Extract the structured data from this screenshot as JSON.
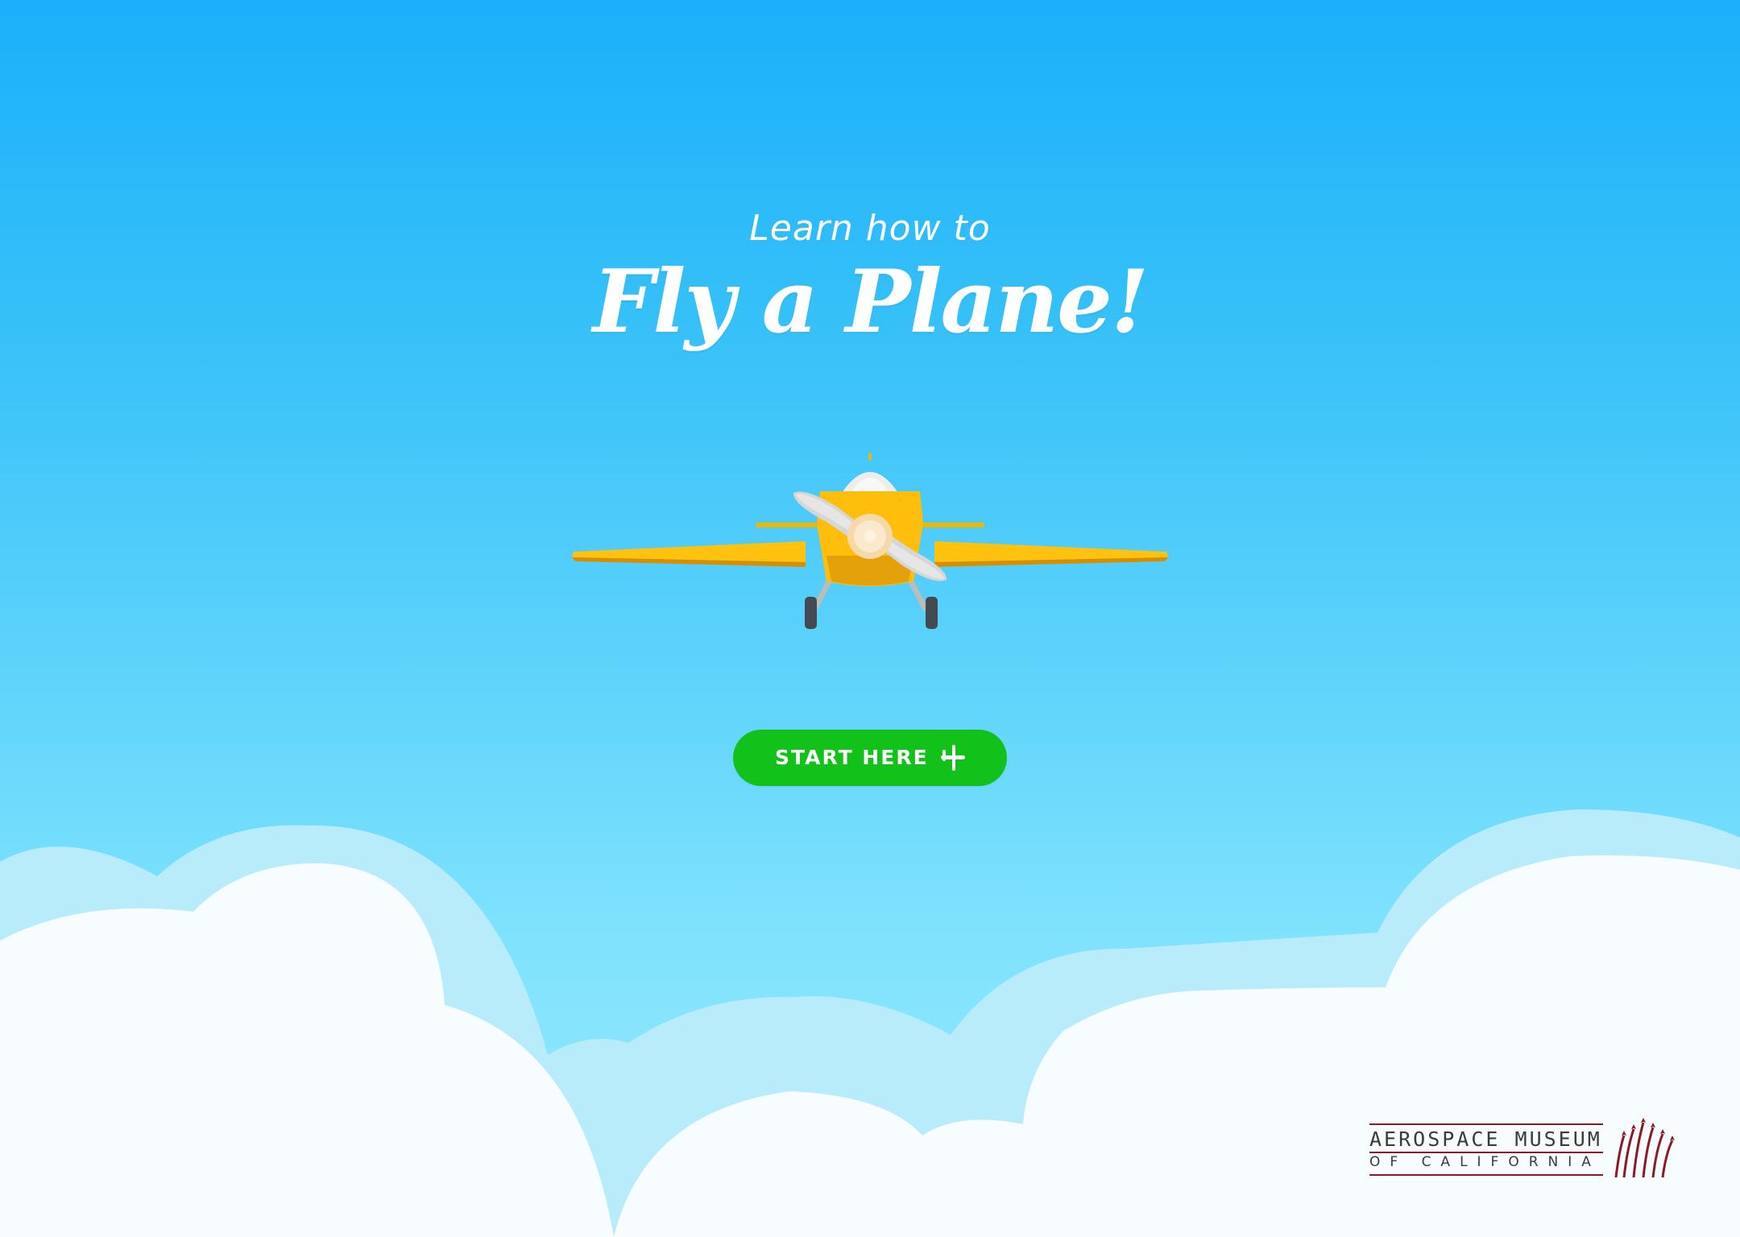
{
  "hero": {
    "subtitle": "Learn how to",
    "title": "Fly a Plane!"
  },
  "cta": {
    "label": "START HERE",
    "icon": "airplane-icon"
  },
  "logo": {
    "line1": "AEROSPACE MUSEUM",
    "line2": "OF CALIFORNIA",
    "emblem": "jet-formation-emblem"
  },
  "colors": {
    "sky_top": "#1bb0fa",
    "sky_bottom": "#98e8fc",
    "button": "#12c21a",
    "plane_body": "#ffbe0b",
    "plane_wing": "#f7b500",
    "cloud_front": "#f7fcfe",
    "cloud_back": "#b8ecfb",
    "logo_red": "#8b1a25"
  }
}
